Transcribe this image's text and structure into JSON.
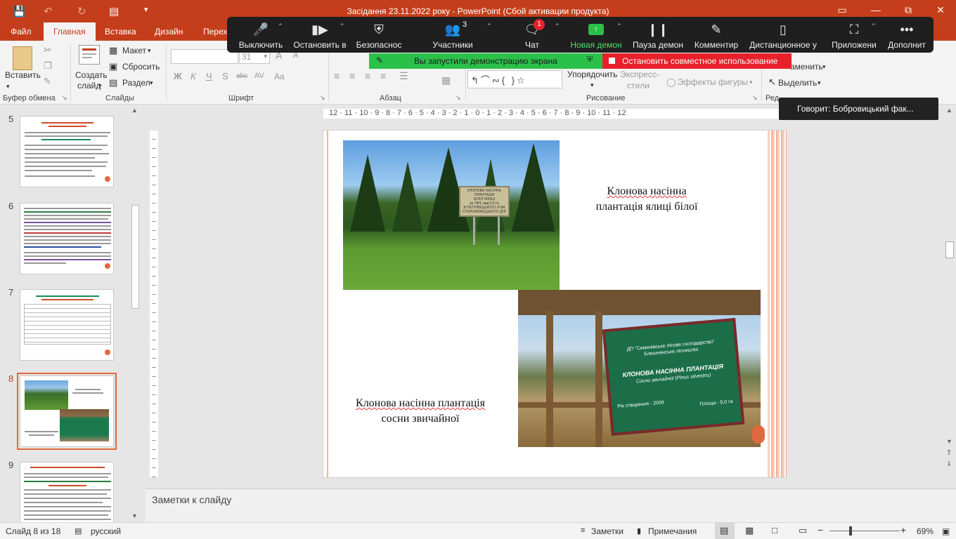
{
  "app": {
    "title": "Засідання 23.11.2022 року - PowerPoint (Сбой активации продукта)"
  },
  "quick_access": {
    "save_icon": "save-icon",
    "undo_icon": "undo-icon",
    "redo_icon": "redo-icon",
    "present_icon": "present-icon"
  },
  "tabs": [
    "Файл",
    "Главная",
    "Вставка",
    "Дизайн",
    "Перех"
  ],
  "active_tab": "Главная",
  "ribbon": {
    "clipboard": {
      "paste": "Вставить",
      "group": "Буфер обмена"
    },
    "slides": {
      "new_slide_line1": "Создать",
      "new_slide_line2": "слайд",
      "layout": "Макет",
      "reset": "Сбросить",
      "section": "Раздел",
      "group": "Слайды"
    },
    "font": {
      "font_name": "",
      "font_size": "31",
      "bold": "Ж",
      "italic": "К",
      "underline": "Ч",
      "shadow": "S",
      "strike": "abc",
      "spacing": "AV",
      "case": "Aa",
      "grow": "A",
      "shrink": "A",
      "group": "Шрифт"
    },
    "paragraph": {
      "group": "Абзац"
    },
    "drawing": {
      "arrange": "Упорядочить",
      "quick_styles_line1": "Экспресс-",
      "quick_styles_line2": "стили",
      "effects": "Эффекты фигуры",
      "group": "Рисование"
    },
    "editing": {
      "replace": "аменить",
      "select": "Выделить",
      "group": "Ред"
    }
  },
  "zoom_toolbar": {
    "buttons": [
      {
        "label": "Выключить",
        "icon": "microphone-icon"
      },
      {
        "label": "Остановить в",
        "icon": "video-camera-icon"
      },
      {
        "label": "Безопаснос",
        "icon": "shield-icon"
      },
      {
        "label": "Участники",
        "icon": "participants-icon",
        "count": "3"
      },
      {
        "label": "Чат",
        "icon": "chat-icon",
        "badge": "1"
      },
      {
        "label": "Новая демон",
        "icon": "share-screen-icon"
      },
      {
        "label": "Пауза демон",
        "icon": "pause-icon"
      },
      {
        "label": "Комментир",
        "icon": "pencil-icon"
      },
      {
        "label": "Дистанционное у",
        "icon": "mouse-icon"
      },
      {
        "label": "Приложени",
        "icon": "apps-icon"
      },
      {
        "label": "Дополнит",
        "icon": "more-icon"
      }
    ],
    "share_banner": "Вы запустили демонстрацию экрана",
    "stop_banner": "Остановить совместное использование",
    "speaking": "Говорит: Бобровицький фак..."
  },
  "thumbnails": [
    {
      "number": "5"
    },
    {
      "number": "6"
    },
    {
      "number": "7"
    },
    {
      "number": "8",
      "selected": true
    },
    {
      "number": "9"
    }
  ],
  "ruler": {
    "h_text": "12 · 11 · 10 · 9 · 8 · 7 · 6 · 5 · 4 · 3 · 2 · 1 · 0 · 1 · 2 · 3 · 4 · 5 · 6 · 7 · 8 · 9 · 10 · 11 · 12"
  },
  "slide": {
    "caption_fir_line1": "Клонова  насінна",
    "caption_fir_line2": "плантація ялиці білої",
    "caption_pine_line1": "Клонова насінна плантація",
    "caption_pine_line2": "сосни звичайної",
    "sign1_line1": "КЛОНОВА НАСІННА",
    "sign1_line2": "ПЛАНТАЦІЯ",
    "sign1_line3": "БІЛОЇ ЯЛИЦІ",
    "sign1_line4": "кв.78/4, вид.5,5 га",
    "sign1_line5": "В-ПЕТРІВЕЦЬКОГО Л-ВА",
    "sign1_line6": "СТОРОЖИНЕЦЬКОГО ДЛГ",
    "sign2_line1": "ДП \"Семенівське лісове господарство\"",
    "sign2_line2": "Блешнянське лісництво",
    "sign2_line3": "КЛОНОВА  НАСІННА  ПЛАНТАЦІЯ",
    "sign2_line4": "Сосни звичайної (Pinus silvestris)",
    "sign2_line5": "Рік створення - 2009",
    "sign2_line6": "Площа - 5,0 га"
  },
  "notes": {
    "placeholder": "Заметки к слайду"
  },
  "statusbar": {
    "slide_info": "Слайд 8 из 18",
    "language": "русский",
    "notes": "Заметки",
    "comments": "Примечания",
    "zoom": "69%"
  },
  "colors": {
    "accent": "#c43e1c",
    "zoom_green": "#2bc04a",
    "zoom_red": "#e8202a",
    "slide_accent": "#e0693f"
  }
}
